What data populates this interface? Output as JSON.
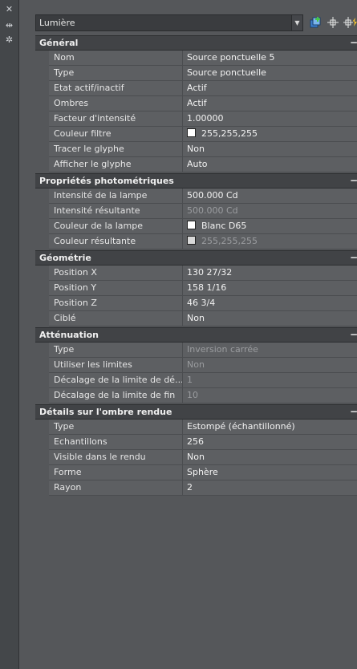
{
  "strip": {
    "icons": [
      "close-icon",
      "auto-hide-icon",
      "properties-icon"
    ]
  },
  "toolbar": {
    "object_type": "Lumière"
  },
  "sections": [
    {
      "title": "Général",
      "rows": [
        {
          "name": "Nom",
          "value": "Source ponctuelle 5"
        },
        {
          "name": "Type",
          "value": "Source ponctuelle"
        },
        {
          "name": "Etat actif/inactif",
          "value": "Actif"
        },
        {
          "name": "Ombres",
          "value": "Actif"
        },
        {
          "name": "Facteur d'intensité",
          "value": "1.00000"
        },
        {
          "name": "Couleur filtre",
          "value": "255,255,255",
          "swatch": true
        },
        {
          "name": "Tracer le glyphe",
          "value": "Non"
        },
        {
          "name": "Afficher le glyphe",
          "value": "Auto"
        }
      ]
    },
    {
      "title": "Propriétés photométriques",
      "rows": [
        {
          "name": "Intensité de la lampe",
          "value": "500.000 Cd"
        },
        {
          "name": "Intensité résultante",
          "value": "500.000 Cd",
          "dim": true
        },
        {
          "name": "Couleur de la lampe",
          "value": "Blanc D65",
          "swatch": true
        },
        {
          "name": "Couleur résultante",
          "value": "255,255,255",
          "swatch": true,
          "dim": true
        }
      ]
    },
    {
      "title": "Géométrie",
      "rows": [
        {
          "name": "Position X",
          "value": "130 27/32"
        },
        {
          "name": "Position Y",
          "value": "158 1/16"
        },
        {
          "name": "Position Z",
          "value": "46 3/4"
        },
        {
          "name": "Ciblé",
          "value": "Non"
        }
      ]
    },
    {
      "title": "Atténuation",
      "rows": [
        {
          "name": "Type",
          "value": "Inversion carrée",
          "dim": true
        },
        {
          "name": "Utiliser les limites",
          "value": "Non",
          "dim": true
        },
        {
          "name": "Décalage de la limite de dé...",
          "value": "1",
          "dim": true
        },
        {
          "name": "Décalage de la limite de fin",
          "value": "10",
          "dim": true
        }
      ]
    },
    {
      "title": "Détails sur l'ombre rendue",
      "rows": [
        {
          "name": "Type",
          "value": "Estompé (échantillonné)"
        },
        {
          "name": "Echantillons",
          "value": "256"
        },
        {
          "name": "Visible dans le rendu",
          "value": "Non"
        },
        {
          "name": "Forme",
          "value": "Sphère"
        },
        {
          "name": "Rayon",
          "value": "2"
        }
      ]
    }
  ],
  "collapse_glyph": "−"
}
